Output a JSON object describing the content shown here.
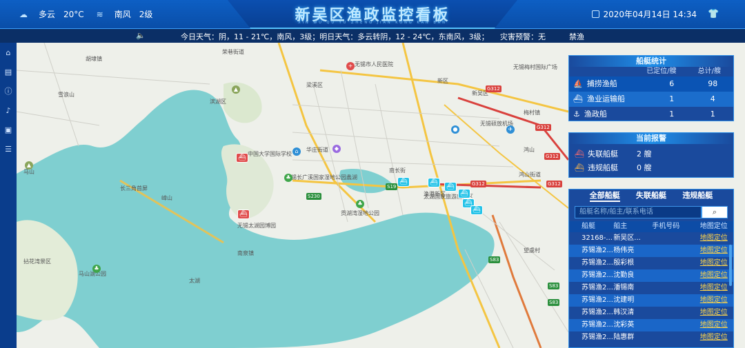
{
  "header": {
    "weather": "多云",
    "temperature": "20°C",
    "wind": "南风",
    "wind_level": "2级",
    "title": "新吴区渔政监控看板",
    "subtitle": "XIN WU QU YU ZHENG JIAN KONG KAN BAN",
    "datetime": "2020年04月14日  14:34"
  },
  "ticker": {
    "weather_text": "今日天气：阴，11 - 21℃，南风，3级；明日天气：多云转阴，12 - 24℃，东南风，3级；",
    "disaster_text": "灾害预警：无",
    "extra_text": "禁渔"
  },
  "rail": {
    "items": [
      "home-icon",
      "document-icon",
      "info-icon",
      "bell-icon",
      "database-icon",
      "menu-icon"
    ]
  },
  "map": {
    "labels": [
      "胡埭镇",
      "荣巷街道",
      "雪浪山",
      "马山",
      "拈花湾景区",
      "嶂山",
      "无锡市人民医院",
      "梁溪区",
      "新吴区",
      "无锡梅村国际广场",
      "南长街",
      "新区",
      "鸿山",
      "华庄街道",
      "太湖国家旅游度假区",
      "滨湖区",
      "无锡长广溪国家湿地公园",
      "蠡湖",
      "太湖",
      "无锡硕放机场",
      "长三角首屏",
      "贡湖湾湿地公园",
      "中国大学国际学校",
      "无锡太湖园博园",
      "梅村镇",
      "鸿山街道",
      "马山湖公园",
      "南泉镇",
      "望虞村",
      "渔港新区"
    ],
    "roads": [
      "G312",
      "G312",
      "G312",
      "G312",
      "G312",
      "S230",
      "S19",
      "S83",
      "S83",
      "S83"
    ]
  },
  "stats": {
    "title": "船艇统计",
    "col_located": "已定位/艘",
    "col_total": "总计/艘",
    "rows": [
      {
        "icon": "fishing-boat-icon",
        "name": "捕捞渔船",
        "located": "6",
        "total": "98"
      },
      {
        "icon": "transport-boat-icon",
        "name": "渔业运输船",
        "located": "1",
        "total": "4"
      },
      {
        "icon": "patrol-boat-icon",
        "name": "渔政船",
        "located": "1",
        "total": "1"
      }
    ]
  },
  "alerts": {
    "title": "当前报警",
    "rows": [
      {
        "icon": "lost-boat-icon",
        "name": "失联船艇",
        "count": "2 艘"
      },
      {
        "icon": "violation-boat-icon",
        "name": "违规船艇",
        "count": "0 艘"
      }
    ]
  },
  "list": {
    "tabs": [
      "全部船艇",
      "失联船艇",
      "违规船艇"
    ],
    "search_placeholder": "船艇名称/船主/联系电话",
    "headers": [
      "船艇",
      "船主",
      "手机号码",
      "地图定位"
    ],
    "rows": [
      {
        "boat": "32168-...",
        "owner": "新吴区...",
        "phone": "",
        "action": "地图定位"
      },
      {
        "boat": "苏锡渔2...",
        "owner": "杨伟亮",
        "phone": "",
        "action": "地图定位"
      },
      {
        "boat": "苏锡渔2...",
        "owner": "殷彩根",
        "phone": "",
        "action": "地图定位"
      },
      {
        "boat": "苏锡渔2...",
        "owner": "沈勤良",
        "phone": "",
        "action": "地图定位"
      },
      {
        "boat": "苏锡渔2...",
        "owner": "潘锡南",
        "phone": "",
        "action": "地图定位"
      },
      {
        "boat": "苏锡渔2...",
        "owner": "沈建明",
        "phone": "",
        "action": "地图定位"
      },
      {
        "boat": "苏锡渔2...",
        "owner": "韩汉清",
        "phone": "",
        "action": "地图定位"
      },
      {
        "boat": "苏锡渔2...",
        "owner": "沈彩英",
        "phone": "",
        "action": "地图定位"
      },
      {
        "boat": "苏锡渔2...",
        "owner": "陆惠群",
        "phone": "",
        "action": "地图定位"
      }
    ]
  },
  "colors": {
    "water": "#7fcfd0",
    "land": "#eef0ea",
    "panel": "#0b4aa8",
    "accent": "#ffd54a",
    "road": "#f4c542",
    "highway": "#d9413d"
  }
}
